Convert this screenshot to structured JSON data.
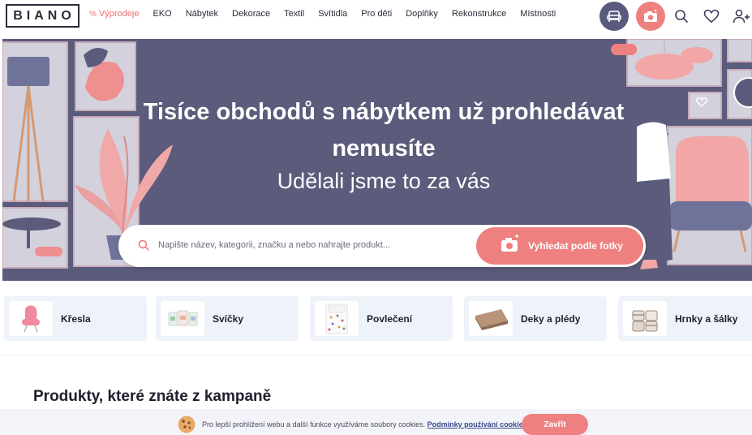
{
  "header": {
    "logo": "BIANO",
    "nav": [
      {
        "label": "Výprodeje",
        "prefix": "%"
      },
      {
        "label": "EKO"
      },
      {
        "label": "Nábytek"
      },
      {
        "label": "Dekorace"
      },
      {
        "label": "Textil"
      },
      {
        "label": "Svítidla"
      },
      {
        "label": "Pro děti"
      },
      {
        "label": "Doplňky"
      },
      {
        "label": "Rekonstrukce"
      },
      {
        "label": "Místnosti"
      }
    ]
  },
  "hero": {
    "title_line1": "Tisíce obchodů s nábytkem už prohledávat",
    "title_line2": "nemusíte",
    "subtitle": "Udělali jsme to za vás",
    "search_placeholder": "Napište název, kategorii, značku a nebo nahrajte produkt...",
    "photo_button": "Vyhledat podle fotky"
  },
  "categories": [
    {
      "label": "Křesla"
    },
    {
      "label": "Svíčky"
    },
    {
      "label": "Povlečení"
    },
    {
      "label": "Deky a plédy"
    },
    {
      "label": "Hrnky a šálky"
    }
  ],
  "section": {
    "title": "Produkty, které znáte z kampaně"
  },
  "cookie": {
    "text": "Pro lepší prohlížení webu a další funkce využíváme soubory cookies.",
    "link": "Podmínky používání cookies",
    "button": "Zavřít"
  },
  "colors": {
    "accent": "#ee8080",
    "hero": "#5b5b7b",
    "sale": "#ee6d6d",
    "category_bg": "#eef2f9"
  }
}
